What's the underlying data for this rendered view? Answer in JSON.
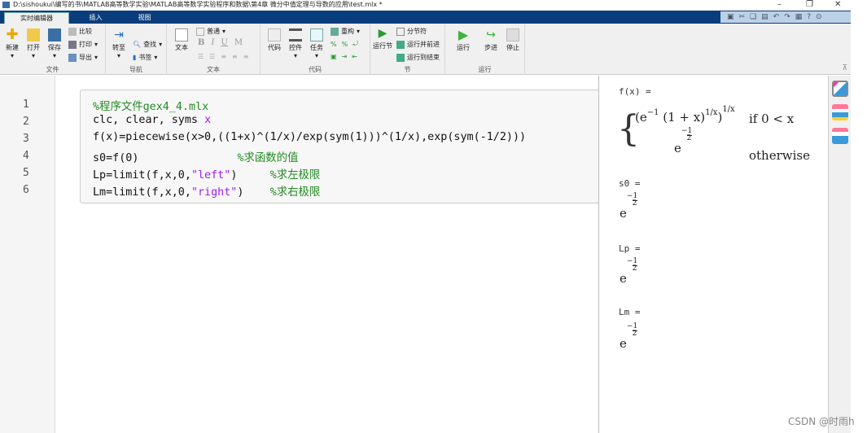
{
  "window": {
    "title": "D:\\sishoukui\\编写的书\\MATLAB高等数学实验\\MATLAB高等数学实验程序和数据\\第4章  微分中值定理与导数的应用\\test.mlx *",
    "controls": [
      "minimize",
      "restore",
      "close"
    ]
  },
  "tabs": [
    {
      "label": "实时编辑器",
      "active": true
    },
    {
      "label": "插入"
    },
    {
      "label": "视图"
    }
  ],
  "ribbon": {
    "file": {
      "label": "文件",
      "new": "新建",
      "open": "打开",
      "save": "保存",
      "compare": "比较",
      "print": "打印",
      "export": "导出"
    },
    "nav": {
      "label": "导航",
      "goto": "转至",
      "find": "查找",
      "bookmark": "书签"
    },
    "text": {
      "label": "文本",
      "text": "文本",
      "style": "普通",
      "bold": "B",
      "italic": "I",
      "underline": "U",
      "mono": "M"
    },
    "code": {
      "label": "代码",
      "code": "代码",
      "control": "控件",
      "task": "任务",
      "refactor": "重构"
    },
    "section": {
      "label": "节",
      "run_section": "运行节",
      "break": "分节符",
      "run_advance": "运行并前进",
      "run_to_end": "运行到结束"
    },
    "run": {
      "label": "运行",
      "run": "运行",
      "step": "步进",
      "stop": "停止"
    }
  },
  "editor": {
    "line_numbers": [
      "1",
      "2",
      "3",
      "4",
      "5",
      "6"
    ],
    "lines": [
      {
        "comment": "%程序文件gex4_4.mlx"
      },
      {
        "code": "clc, clear, syms ",
        "var": "x"
      },
      {
        "code": "f(x)=piecewise(x>0,((1+x)^(1/x)/exp(sym(1)))^(1/x),exp(sym(-1/2)))"
      },
      {
        "code": "s0=f(0)               ",
        "comment": "%求函数的值"
      },
      {
        "code": "Lp=limit(f,x,0,",
        "str": "\"left\"",
        "close": ")     ",
        "comment": "%求左极限"
      },
      {
        "code": "Lm=limit(f,x,0,",
        "str": "\"right\"",
        "close": ")    ",
        "comment": "%求右极限"
      }
    ]
  },
  "output": {
    "f_label": "f(x) =",
    "case1": "(e",
    "case1_exp": "−1",
    "case1_mid": " (1 + x)",
    "case1_inner": "1/x",
    "case1_end": ")",
    "case1_outer": "1/x",
    "cond1": "if  0 < x",
    "cond2": "otherwise",
    "e": "e",
    "neg": "−",
    "num": "1",
    "den": "2",
    "s0_label": "s0 =",
    "lp_label": "Lp =",
    "lm_label": "Lm ="
  },
  "sidebar": {
    "icons": [
      "output-inline-icon",
      "output-right-icon",
      "hide-code-icon"
    ]
  },
  "watermark": "CSDN @时雨h",
  "colors": {
    "tabbar": "#0a3d7c",
    "comment": "#228b22",
    "string": "#a020f0"
  }
}
